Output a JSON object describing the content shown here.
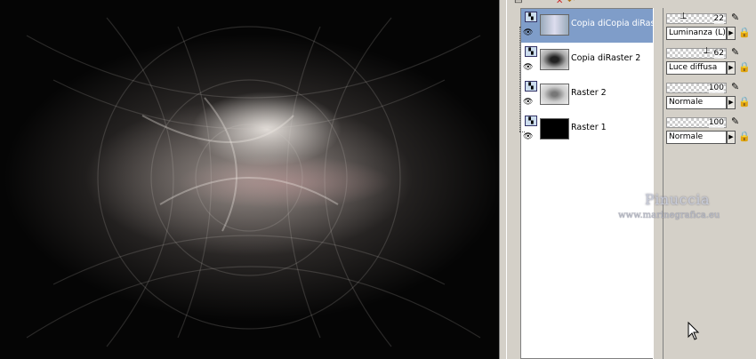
{
  "layers": [
    {
      "name": "Copia diCopia diRaster",
      "opacity": "22",
      "blend": "Luminanza (L)",
      "selected": true,
      "thumb": "blue-pattern"
    },
    {
      "name": "Copia diRaster 2",
      "opacity": "62",
      "blend": "Luce diffusa",
      "selected": false,
      "thumb": "dark-pattern"
    },
    {
      "name": "Raster 2",
      "opacity": "100",
      "blend": "Normale",
      "selected": false,
      "thumb": "gray-pattern"
    },
    {
      "name": "Raster 1",
      "opacity": "100",
      "blend": "Normale",
      "selected": false,
      "thumb": "black"
    }
  ],
  "watermark": {
    "title": "Pinuccia",
    "url": "www.marinegrafica.eu"
  },
  "icons": {
    "visibility": "eye-icon",
    "layer_type": "raster-layer-icon",
    "lock": "lock-icon",
    "edit": "brush-edit-icon",
    "cursor": "mouse-cursor"
  },
  "colors": {
    "selection": "#7f9dc9",
    "panel_bg": "#d4d0c8"
  }
}
